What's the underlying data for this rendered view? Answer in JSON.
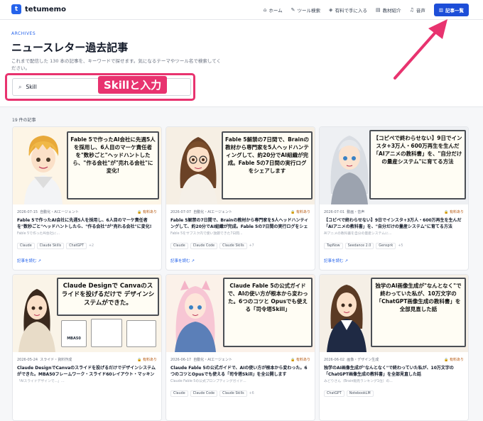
{
  "nav": {
    "logo_text": "tetumemo",
    "logo_mark": "t",
    "links": [
      {
        "label": "ホーム",
        "icon": "home-icon"
      },
      {
        "label": "ツール検索",
        "icon": "wrench-icon"
      },
      {
        "label": "有料で手に入る",
        "icon": "tag-icon"
      },
      {
        "label": "教材紹介",
        "icon": "book-icon"
      },
      {
        "label": "音声",
        "icon": "headphones-icon"
      }
    ],
    "active_button": "記事一覧"
  },
  "hero": {
    "eyebrow": "ARCHIVES",
    "title": "ニュースレター過去記事",
    "description": "これまで配信した 130 本の記事を、キーワードで探せます。気になるテーマやツール名で検索してください。"
  },
  "search": {
    "value": "Skill",
    "placeholder": ""
  },
  "annotation": {
    "label": "Skillと入力",
    "color": "#e8336f"
  },
  "results": {
    "count_label": "19 件の記事"
  },
  "cards": [
    {
      "board_text": "Fable 5で作ったAI会社に先週5人を採用し、6人目のマーケ責任者を\"数秒ごと\"ヘッドハントしたら、\"作る会社\"が\"売れる会社\"に変化!",
      "date": "2026-07-15",
      "category": "自動化・AIエージェント",
      "badge": "有料あり",
      "title": "Fable 5で作ったAI会社に先週5人を採用し、6人目のマーケ責任者を\"数秒ごと\"ヘッドハントしたら、\"作る会社\"が\"売れる会社\"に変化!",
      "desc": "Fable 5で作ったAI会社に...",
      "tags": [
        "Claude",
        "Claude Skills",
        "ChatGPT"
      ],
      "more": "+2",
      "read": "記事を読む"
    },
    {
      "board_text": "Fable 5解禁の7日間で、Brainの教材から専門家を5人ヘッドハンティングして、約20分でAI組織が完成。Fable 5の7日間の実行ログをシェアします",
      "date": "2026-07-07",
      "category": "自動化・AIエージェント",
      "badge": "有料あり",
      "title": "Fable 5解禁の7日間で、Brainの教材から専門家を5人ヘッドハンティングして、約20分でAI組織が完成。Fable 5の7日間の実行ログをシェアします",
      "desc": "Fable 5をサブスク内で使い放題できた7日間...",
      "tags": [
        "Claude",
        "Claude Code",
        "Claude Skills"
      ],
      "more": "+7",
      "read": "記事を読む"
    },
    {
      "board_text": "【コピペで終わらせない】9日でインスタ+3万人・600万再生を生んだ「AIアニメの教科書」を、\"自分だけの量産システム\"に育てる方法",
      "date": "2026-07-01",
      "category": "動画・音声",
      "badge": "有料あり",
      "title": "【コピペで終わらせない】9日でインスタ+3万人・600万再生を生んだ「AIアニメの教科書」を、\"自分だけの量産システム\"に育てる方法",
      "desc": "AIアニメの教科書を自分の量産システムに...",
      "tags": [
        "TapNow",
        "Seedance 2.0",
        "Gensprk"
      ],
      "more": "+5",
      "read": "記事を読む"
    },
    {
      "board_text": "Claude Designで Canvaのスライドを投げるだけで デザインシステムができた。",
      "date": "2026-05-24",
      "category": "スライド・資料作成",
      "badge": "有料あり",
      "title": "Claude DesignでCanvaのスライドを投げるだけでデザインシステムができた。MBA50フレームワーク・スライド60レイアウト・マッキンゼ...",
      "desc": "「AIスライドデザインで...」...",
      "tags": [],
      "more": "",
      "read": "記事を読む"
    },
    {
      "board_text": "Claude Fable 5の公式ガイドで、AIの使い方が根本から変わった。6つのコツと Opusでも使える「司令塔Skill」",
      "date": "2026-06-17",
      "category": "自動化・AIエージェント",
      "badge": "有料あり",
      "title": "Claude Fable 5の公式ガイドで、AIの使い方が根本から変わった。6つのコツとOpusでも使える「司令塔Skill」を全公開します",
      "desc": "Claude Fable 5の公式プロンプティングガイド...",
      "tags": [
        "Claude",
        "Claude Code",
        "Claude Skills"
      ],
      "more": "+6",
      "read": "記事を読む"
    },
    {
      "board_text": "独学のAI画像生成が\"なんとなく\"で終わっていた私が、10万文字の「ChatGPT画像生成の教科書」を全部見直した話",
      "date": "2026-06-02",
      "category": "画像・デザイン生成",
      "badge": "有料あり",
      "title": "独学のAI画像生成が\"なんとなく\"で終わっていた私が、10万文字の「ChatGPT画像生成の教科書」を全部見直した話",
      "desc": "みどりさん（Brain販売ランキング1位）の...",
      "tags": [
        "ChatGPT",
        "NotebookLM"
      ],
      "more": "",
      "read": "記事を読む"
    }
  ]
}
